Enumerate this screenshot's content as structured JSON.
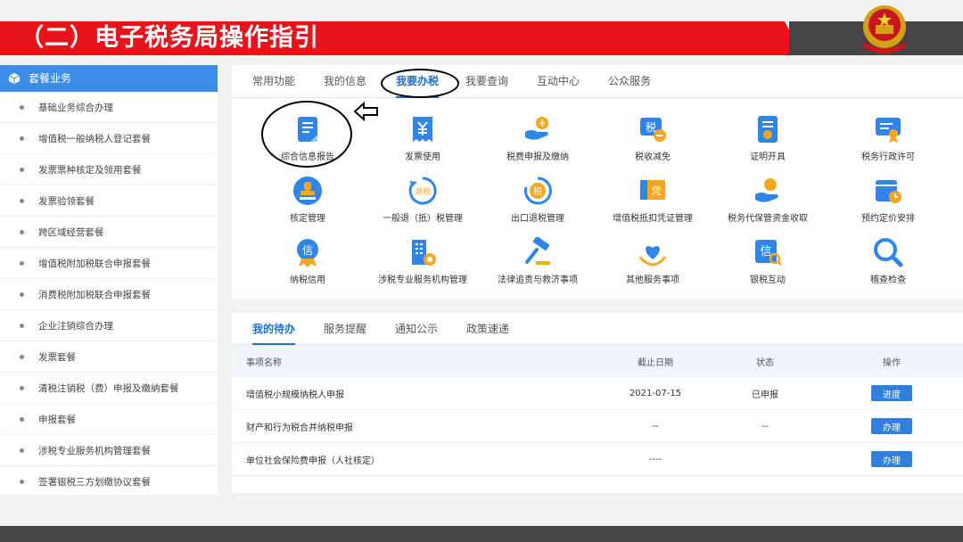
{
  "header": {
    "title": "（二）电子税务局操作指引"
  },
  "sidebar": {
    "title": "套餐业务",
    "items": [
      "基础业务综合办理",
      "增值税一般纳税人登记套餐",
      "发票票种核定及领用套餐",
      "发票验领套餐",
      "跨区域经营套餐",
      "增值税附加税联合申报套餐",
      "消费税附加税联合申报套餐",
      "企业注销综合办理",
      "发票套餐",
      "清税注销税（费）申报及缴纳套餐",
      "申报套餐",
      "涉税专业服务机构管理套餐",
      "签署银税三方划缴协议套餐"
    ]
  },
  "main_tabs": [
    "常用功能",
    "我的信息",
    "我要办税",
    "我要查询",
    "互动中心",
    "公众服务"
  ],
  "services": [
    "综合信息报告",
    "发票使用",
    "税费申报及缴纳",
    "税收减免",
    "证明开具",
    "税务行政许可",
    "核定管理",
    "一般退（抵）税管理",
    "出口退税管理",
    "增值税抵扣凭证管理",
    "税务代保管资金收取",
    "预约定价安排",
    "纳税信用",
    "涉税专业服务机构管理",
    "法律追责与救济事项",
    "其他服务事项",
    "银税互动",
    "稽查检查"
  ],
  "icon_text": {
    "tax": "税",
    "refund": "退税",
    "voucher": "凭",
    "credit": "信",
    "bank": "信"
  },
  "todo": {
    "tabs": [
      "我的待办",
      "服务提醒",
      "通知公示",
      "政策速递"
    ],
    "columns": {
      "name": "事项名称",
      "deadline": "截止日期",
      "status": "状态",
      "action": "操作"
    },
    "rows": [
      {
        "name": "增值税小规模纳税人申报",
        "deadline": "2021-07-15",
        "status": "已申报",
        "action": "进度"
      },
      {
        "name": "财产和行为税合并纳税申报",
        "deadline": "--",
        "status": "--",
        "action": "办理"
      },
      {
        "name": "单位社会保险费申报（人社核定）",
        "deadline": "----",
        "status": "",
        "action": "办理"
      }
    ]
  },
  "colors": {
    "brand_red": "#e8141c",
    "accent_blue": "#1d6fd8",
    "icon_blue": "#2f86e8",
    "icon_orange": "#f5a623"
  }
}
